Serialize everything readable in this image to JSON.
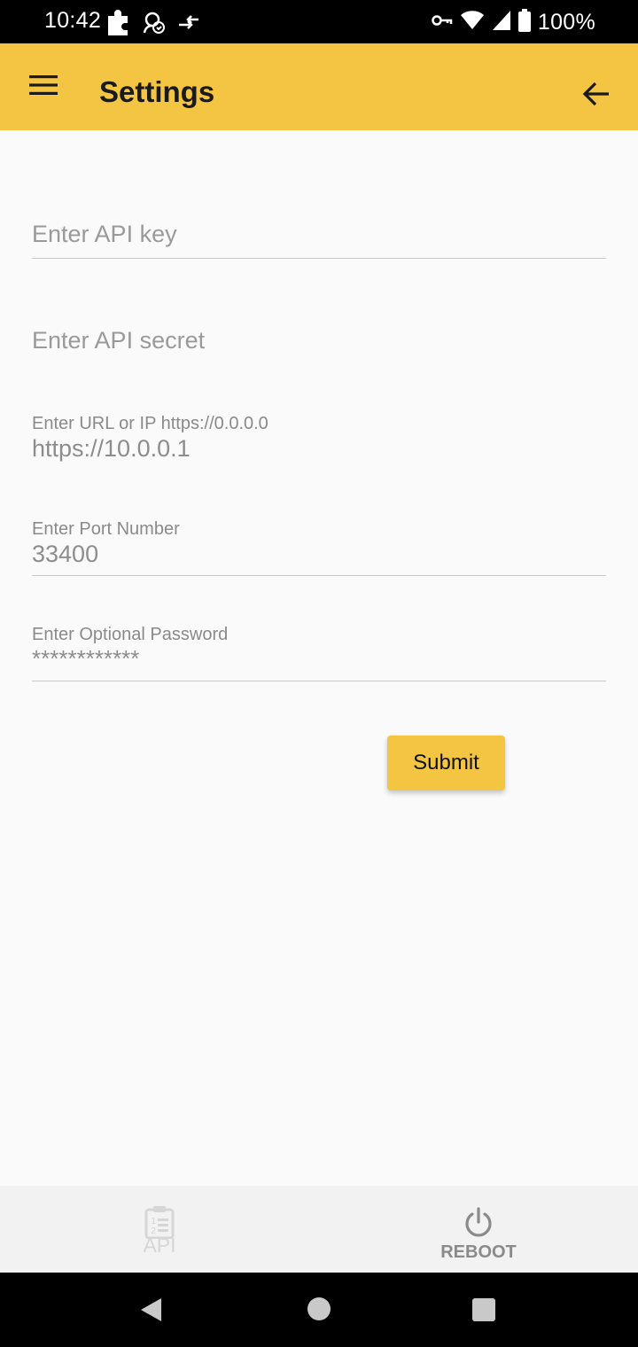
{
  "status_bar": {
    "time": "10:42",
    "battery": "100%",
    "left_icons": [
      "puzzle-icon",
      "sync-account-icon",
      "data-transfer-icon"
    ],
    "right_icons": [
      "vpn-key-icon",
      "wifi-icon",
      "cell-signal-icon",
      "battery-icon"
    ]
  },
  "app_bar": {
    "title": "Settings",
    "accent_color": "#f4c443"
  },
  "form": {
    "api_key": {
      "placeholder": "Enter API key",
      "value": ""
    },
    "api_secret": {
      "placeholder": "Enter API secret",
      "value": ""
    },
    "url": {
      "label": "Enter URL or IP https://0.0.0.0",
      "value": "https://10.0.0.1"
    },
    "port": {
      "label": "Enter Port Number",
      "value": "33400"
    },
    "password": {
      "label": "Enter Optional Password",
      "value": "************"
    },
    "submit_label": "Submit"
  },
  "bottom_nav": {
    "items": [
      {
        "label": "API",
        "icon": "clipboard-list-icon",
        "state": "disabled"
      },
      {
        "label": "REBOOT",
        "icon": "power-icon",
        "state": "enabled"
      }
    ]
  },
  "system_nav": [
    "back-triangle-icon",
    "home-circle-icon",
    "recents-square-icon"
  ]
}
